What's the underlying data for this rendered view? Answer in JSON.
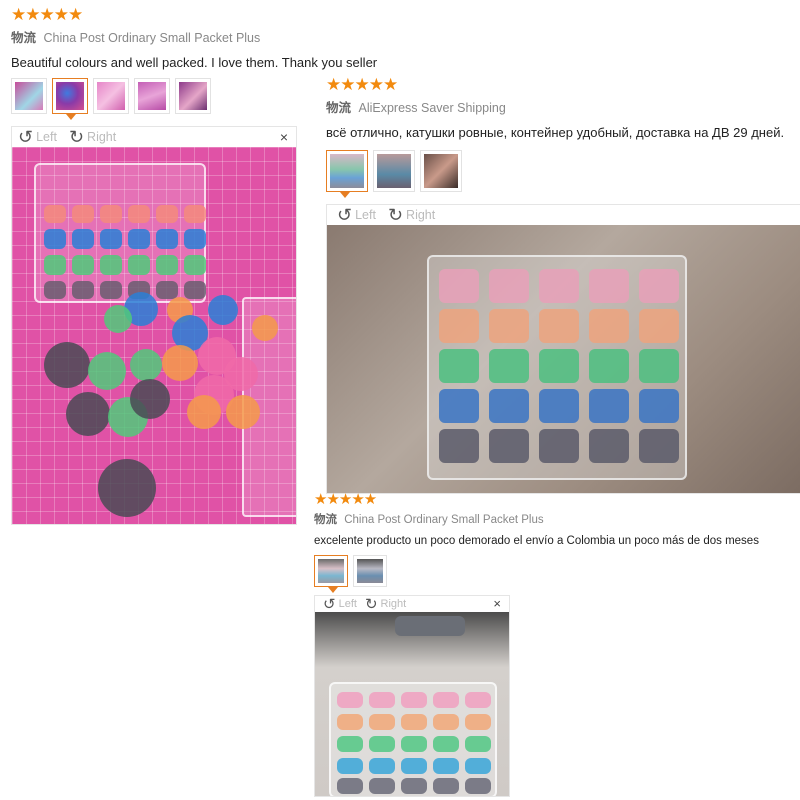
{
  "reviews": [
    {
      "stars": "★★★★★",
      "shipping_label": "物流",
      "shipping": "China Post Ordinary Small Packet Plus",
      "comment": "Beautiful colours and well packed. I love them. Thank you seller",
      "thumb_count": 5,
      "selected_thumb": 2
    },
    {
      "stars": "★★★★★",
      "shipping_label": "物流",
      "shipping": "AliExpress Saver Shipping",
      "comment": "всё отлично, катушки ровные, контейнер удобный, доставка на ДВ 29 дней.",
      "thumb_count": 3,
      "selected_thumb": 1
    },
    {
      "stars": "★★★★★",
      "shipping_label": "物流",
      "shipping": "China Post Ordinary Small Packet Plus",
      "comment": "excelente producto un poco demorado el envío a Colombia un poco más de dos meses",
      "thumb_count": 2,
      "selected_thumb": 1
    }
  ],
  "viewer": {
    "rotate_left_icon": "↺",
    "rotate_left_label": "Left",
    "rotate_right_icon": "↻",
    "rotate_right_label": "Right",
    "close_icon": "×"
  },
  "colors": {
    "star": "#f28a0e",
    "selected_border": "#e67e22",
    "bobbin_pink": "#f06aa8",
    "bobbin_orange": "#f59a4a",
    "bobbin_green": "#3ec46a",
    "bobbin_blue": "#2a7fd6",
    "bobbin_dark": "#4a4a55"
  }
}
